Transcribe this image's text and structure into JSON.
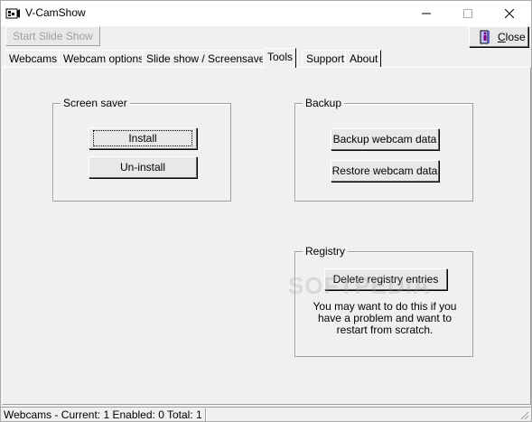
{
  "window": {
    "title": "V-CamShow",
    "icon": "camera-app-icon"
  },
  "toolbar": {
    "start_slideshow_label": "Start Slide Show",
    "close_label_underlined": "C",
    "close_label_rest": "lose"
  },
  "tabs": [
    {
      "label": "Webcams",
      "active": false
    },
    {
      "label": "Webcam options",
      "active": false
    },
    {
      "label": "Slide show / Screensaver",
      "active": false
    },
    {
      "label": "Tools",
      "active": true
    },
    {
      "label": "Support",
      "active": false
    },
    {
      "label": "About",
      "active": false
    }
  ],
  "tools": {
    "screensaver": {
      "title": "Screen saver",
      "install_label": "Install",
      "uninstall_label": "Un-install"
    },
    "backup": {
      "title": "Backup",
      "backup_label": "Backup webcam data",
      "restore_label": "Restore webcam data"
    },
    "registry": {
      "title": "Registry",
      "delete_label": "Delete registry entries",
      "note": "You may want to do this if you have a problem and want to restart from scratch."
    }
  },
  "statusbar": {
    "text": "Webcams - Current: 1  Enabled: 0  Total: 1"
  },
  "watermark": "SOFTPEDIA",
  "colors": {
    "background": "#f0f0f0",
    "disabled_text": "#a0a0a0",
    "border_dark": "#696969"
  }
}
